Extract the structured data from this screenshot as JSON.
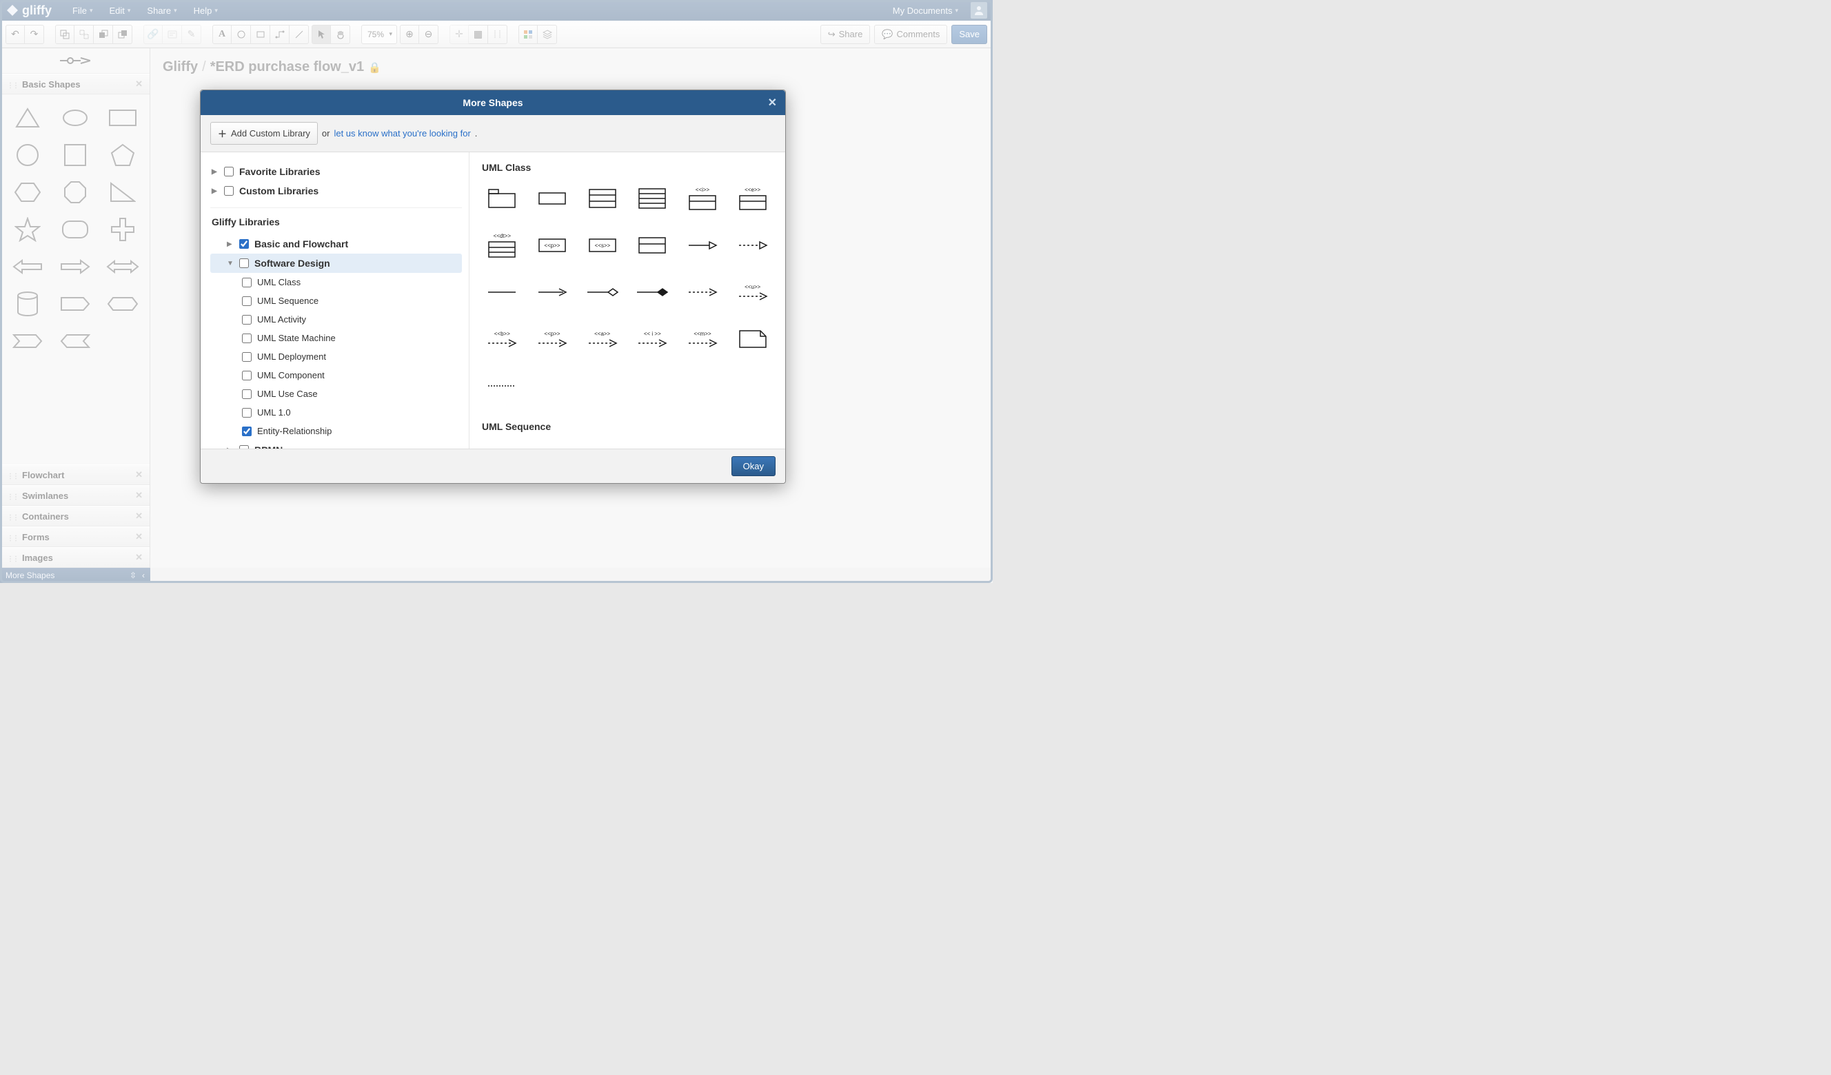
{
  "app": {
    "name": "gliffy"
  },
  "menubar": {
    "items": [
      "File",
      "Edit",
      "Share",
      "Help"
    ],
    "my_documents": "My Documents"
  },
  "toolbar": {
    "zoom": "75%",
    "share": "Share",
    "comments": "Comments",
    "save": "Save"
  },
  "breadcrumb": {
    "root": "Gliffy",
    "doc": "*ERD purchase flow_v1"
  },
  "sidebar": {
    "shape_library_header": "Basic Shapes",
    "collapsed_sections": [
      "Flowchart",
      "Swimlanes",
      "Containers",
      "Forms",
      "Images"
    ],
    "more_shapes": "More Shapes"
  },
  "modal": {
    "title": "More Shapes",
    "add_custom": "Add Custom Library",
    "or_text": "or ",
    "feedback_link": "let us know what you're looking for",
    "period": ".",
    "groups": {
      "favorite": "Favorite Libraries",
      "custom": "Custom Libraries",
      "gliffy_heading": "Gliffy Libraries"
    },
    "libraries": [
      {
        "label": "Basic and Flowchart",
        "checked": true,
        "expanded": false,
        "level": "sub"
      },
      {
        "label": "Software Design",
        "checked": false,
        "expanded": true,
        "level": "sub",
        "highlighted": true
      },
      {
        "label": "UML Class",
        "checked": false,
        "level": "subsub"
      },
      {
        "label": "UML Sequence",
        "checked": false,
        "level": "subsub"
      },
      {
        "label": "UML Activity",
        "checked": false,
        "level": "subsub"
      },
      {
        "label": "UML State Machine",
        "checked": false,
        "level": "subsub"
      },
      {
        "label": "UML Deployment",
        "checked": false,
        "level": "subsub"
      },
      {
        "label": "UML Component",
        "checked": false,
        "level": "subsub"
      },
      {
        "label": "UML Use Case",
        "checked": false,
        "level": "subsub"
      },
      {
        "label": "UML 1.0",
        "checked": false,
        "level": "subsub"
      },
      {
        "label": "Entity-Relationship",
        "checked": true,
        "level": "subsub"
      },
      {
        "label": "BPMN",
        "checked": false,
        "expanded": false,
        "level": "sub"
      }
    ],
    "preview": {
      "uml_class_title": "UML Class",
      "uml_sequence_title": "UML Sequence",
      "labels": {
        "i": "<<i>>",
        "e": "<<e>>",
        "dt": "<<dt>>",
        "p": "<<p>>",
        "s": "<<s>>",
        "u": "<<u>>",
        "b": "<<b>>",
        "p2": "<<p>>",
        "a": "<<a>>",
        "i2": "<< i >>",
        "m": "<<m>>"
      }
    },
    "ok": "Okay"
  }
}
